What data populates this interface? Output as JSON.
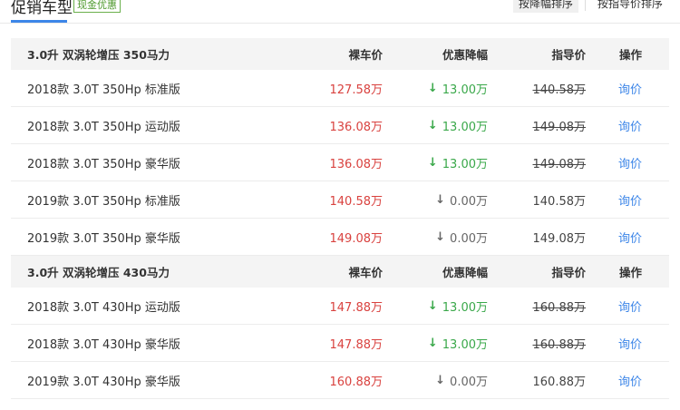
{
  "header": {
    "title": "促销车型",
    "badge": "现金优惠",
    "sort_buttons": [
      "按降幅排序",
      "按指导价排序"
    ]
  },
  "columns": {
    "price": "裸车价",
    "discount": "优惠降幅",
    "guide": "指导价",
    "action": "操作"
  },
  "groups": [
    {
      "name": "3.0升 双涡轮增压 350马力",
      "rows": [
        {
          "model": "2018款 3.0T 350Hp 标准版",
          "price": "127.58万",
          "discount": "13.00万",
          "discount_dir": "down",
          "guide": "140.58万",
          "struck": true,
          "action": "询价"
        },
        {
          "model": "2018款 3.0T 350Hp 运动版",
          "price": "136.08万",
          "discount": "13.00万",
          "discount_dir": "down",
          "guide": "149.08万",
          "struck": true,
          "action": "询价"
        },
        {
          "model": "2018款 3.0T 350Hp 豪华版",
          "price": "136.08万",
          "discount": "13.00万",
          "discount_dir": "down",
          "guide": "149.08万",
          "struck": true,
          "action": "询价"
        },
        {
          "model": "2019款 3.0T 350Hp 标准版",
          "price": "140.58万",
          "discount": "0.00万",
          "discount_dir": "none",
          "guide": "140.58万",
          "struck": false,
          "action": "询价"
        },
        {
          "model": "2019款 3.0T 350Hp 豪华版",
          "price": "149.08万",
          "discount": "0.00万",
          "discount_dir": "none",
          "guide": "149.08万",
          "struck": false,
          "action": "询价"
        }
      ]
    },
    {
      "name": "3.0升 双涡轮增压 430马力",
      "rows": [
        {
          "model": "2018款 3.0T 430Hp 运动版",
          "price": "147.88万",
          "discount": "13.00万",
          "discount_dir": "down",
          "guide": "160.88万",
          "struck": true,
          "action": "询价"
        },
        {
          "model": "2018款 3.0T 430Hp 豪华版",
          "price": "147.88万",
          "discount": "13.00万",
          "discount_dir": "down",
          "guide": "160.88万",
          "struck": true,
          "action": "询价"
        },
        {
          "model": "2019款 3.0T 430Hp 豪华版",
          "price": "160.88万",
          "discount": "0.00万",
          "discount_dir": "none",
          "guide": "160.88万",
          "struck": false,
          "action": "询价"
        }
      ]
    }
  ],
  "colors": {
    "accent": "#3d86e8",
    "price": "#d9423f",
    "discount": "#3aa84a",
    "badge": "#4f9a2e"
  },
  "icons": {
    "down": "arrow-down-icon",
    "none": "arrow-down-gray-icon"
  }
}
